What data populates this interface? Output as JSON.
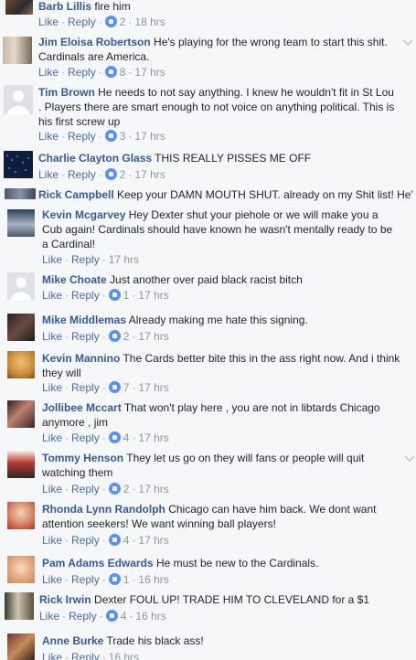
{
  "labels": {
    "like": "Like",
    "reply": "Reply",
    "sep": "·"
  },
  "comments": [
    {
      "name": "Barb Lillis",
      "text": "fire him",
      "likes": "2",
      "time": "18 hrs"
    },
    {
      "name": "Jim Eloisa Robertson",
      "text": "He's playing for the wrong team to start this shit. Cardinals are America.",
      "likes": "8",
      "time": "17 hrs"
    },
    {
      "name": "Tim Brown",
      "text": "He needs to not say anything. I knew he wouldn't fit in St Lou . Players there are smart enough to not voice on anything political. This is his first screw up",
      "likes": "3",
      "time": "17 hrs"
    },
    {
      "name": "Charlie Clayton Glass",
      "text": "THIS REALLY PISSES ME OFF",
      "likes": "2",
      "time": "17 hrs"
    },
    {
      "name": "Rick Campbell",
      "text": "Keep your DAMN MOUTH SHUT. already on my Shit list! He's"
    },
    {
      "name": "Kevin Mcgarvey",
      "text": "Hey Dexter shut your piehole or we will make you a Cub again! Cardinals should have known he wasn't mentally ready to be a Cardinal!",
      "time": "17 hrs"
    },
    {
      "name": "Mike Choate",
      "text": "Just another over paid black racist bitch",
      "likes": "1",
      "time": "17 hrs"
    },
    {
      "name": "Mike Middlemas",
      "text": "Already making me hate this signing.",
      "likes": "2",
      "time": "17 hrs"
    },
    {
      "name": "Kevin Mannino",
      "text": "The Cards better bite this in the ass right now. And i think they will",
      "likes": "7",
      "time": "17 hrs"
    },
    {
      "name": "Jollibee Mccart",
      "text": "That won't play here , you are not in libtards Chicago anymore , jim",
      "likes": "4",
      "time": "17 hrs"
    },
    {
      "name": "Tommy Henson",
      "text": "They let us go on they will fans or people will quit watching them",
      "likes": "2",
      "time": "17 hrs"
    },
    {
      "name": "Rhonda Lynn Randolph",
      "text": "Chicago can have him back. We dont want attention seekers! We want winning ball players!",
      "likes": "4",
      "time": "17 hrs"
    },
    {
      "name": "Pam Adams Edwards",
      "text": "He must be new to the Cardinals.",
      "likes": "1",
      "time": "16 hrs"
    },
    {
      "name": "Rick Irwin",
      "text": "Dexter FOUL UP! TRADE HIM TO CLEVELAND for a $1",
      "likes": "4",
      "time": "16 hrs"
    },
    {
      "name": "Anne Burke",
      "text": "Trade his black ass!",
      "time": "16 hrs"
    }
  ]
}
